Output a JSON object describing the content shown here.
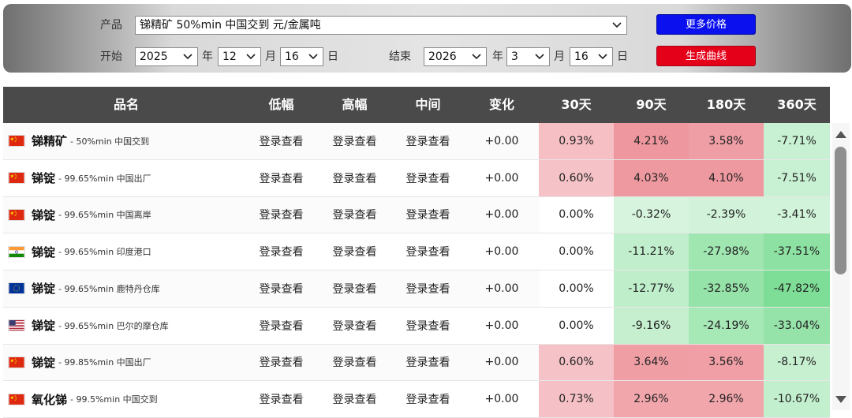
{
  "filters": {
    "product_label": "产品",
    "product_value": "锑精矿 50%min 中国交到 元/金属吨",
    "start_label": "开始",
    "start_year": "2025",
    "start_month": "12",
    "start_day": "16",
    "end_label": "结束",
    "end_year": "2026",
    "end_month": "3",
    "end_day": "16",
    "unit_year": "年",
    "unit_month": "月",
    "unit_day": "日",
    "more_price_button": "更多价格",
    "curve_button": "生成曲线"
  },
  "table": {
    "headers": [
      "品名",
      "低幅",
      "高幅",
      "中间",
      "变化",
      "30天",
      "90天",
      "180天",
      "360天"
    ],
    "rows": [
      {
        "flag": "china",
        "name": "锑精矿",
        "desc": "50%min 中国交到",
        "low": "登录查看",
        "high": "登录查看",
        "mid": "登录查看",
        "change": "+0.00",
        "d30": "0.93%",
        "d90": "4.21%",
        "d180": "3.58%",
        "d360": "-7.71%"
      },
      {
        "flag": "china",
        "name": "锑锭",
        "desc": "99.65%min 中国出厂",
        "low": "登录查看",
        "high": "登录查看",
        "mid": "登录查看",
        "change": "+0.00",
        "d30": "0.60%",
        "d90": "4.03%",
        "d180": "4.10%",
        "d360": "-7.51%"
      },
      {
        "flag": "china",
        "name": "锑锭",
        "desc": "99.65%min 中国离岸",
        "low": "登录查看",
        "high": "登录查看",
        "mid": "登录查看",
        "change": "+0.00",
        "d30": "0.00%",
        "d90": "-0.32%",
        "d180": "-2.39%",
        "d360": "-3.41%"
      },
      {
        "flag": "india",
        "name": "锑锭",
        "desc": "99.65%min 印度港口",
        "low": "登录查看",
        "high": "登录查看",
        "mid": "登录查看",
        "change": "+0.00",
        "d30": "0.00%",
        "d90": "-11.21%",
        "d180": "-27.98%",
        "d360": "-37.51%"
      },
      {
        "flag": "eu",
        "name": "锑锭",
        "desc": "99.65%min 鹿特丹仓库",
        "low": "登录查看",
        "high": "登录查看",
        "mid": "登录查看",
        "change": "+0.00",
        "d30": "0.00%",
        "d90": "-12.77%",
        "d180": "-32.85%",
        "d360": "-47.82%"
      },
      {
        "flag": "usa",
        "name": "锑锭",
        "desc": "99.65%min 巴尔的摩仓库",
        "low": "登录查看",
        "high": "登录查看",
        "mid": "登录查看",
        "change": "+0.00",
        "d30": "0.00%",
        "d90": "-9.16%",
        "d180": "-24.19%",
        "d360": "-33.04%"
      },
      {
        "flag": "china",
        "name": "锑锭",
        "desc": "99.85%min 中国出厂",
        "low": "登录查看",
        "high": "登录查看",
        "mid": "登录查看",
        "change": "+0.00",
        "d30": "0.60%",
        "d90": "3.64%",
        "d180": "3.56%",
        "d360": "-8.17%"
      },
      {
        "flag": "china",
        "name": "氧化锑",
        "desc": "99.5%min 中国交到",
        "low": "登录查看",
        "high": "登录查看",
        "mid": "登录查看",
        "change": "+0.00",
        "d30": "0.73%",
        "d90": "2.96%",
        "d180": "2.96%",
        "d360": "-10.67%"
      }
    ]
  },
  "colors": {
    "more_button": "#0a10ee",
    "curve_button": "#e5001a",
    "header_bg": "#4a4a4a",
    "positive": "#f4a5aa",
    "negative": "#5fd87a"
  }
}
